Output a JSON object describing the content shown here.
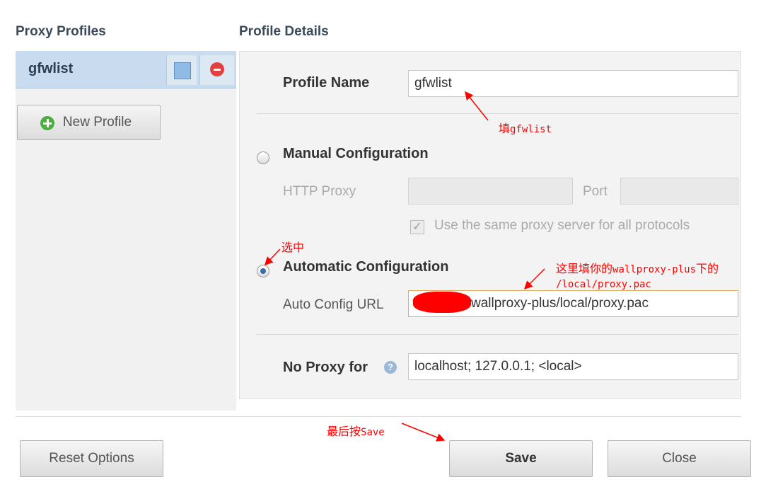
{
  "left": {
    "title": "Proxy Profiles",
    "profiles": [
      {
        "name": "gfwlist"
      }
    ],
    "new_profile_label": "New Profile"
  },
  "details": {
    "title": "Profile Details",
    "profile_name_label": "Profile Name",
    "profile_name_value": "gfwlist",
    "manual_label": "Manual Configuration",
    "http_proxy_label": "HTTP Proxy",
    "http_proxy_value": "",
    "port_label": "Port",
    "port_value": "",
    "same_proxy_label": "Use the same proxy server for all protocols",
    "same_proxy_checked": true,
    "automatic_label": "Automatic Configuration",
    "auto_url_label": "Auto Config URL",
    "auto_url_value": "wallproxy-plus/local/proxy.pac",
    "no_proxy_label": "No Proxy for",
    "no_proxy_value": "localhost; 127.0.0.1; <local>",
    "selected_mode": "automatic"
  },
  "footer": {
    "reset_label": "Reset Options",
    "save_label": "Save",
    "close_label": "Close"
  },
  "annotations": {
    "fill_prefix": "填",
    "fill_code": "gfwlist",
    "select": "选中",
    "url_note_prefix": "这里填你的",
    "url_note_code": "wallproxy-plus",
    "url_note_suffix": "下的",
    "url_note_path": "/local/proxy.pac",
    "save_note_prefix": "最后按",
    "save_note_code": "Save"
  },
  "colors": {
    "annotation": "#ff0000",
    "selected_profile_bg": "#c9dcef",
    "profile_color": "#8fbbe6"
  },
  "icons": [
    "color-swatch-icon",
    "delete-icon",
    "plus-icon",
    "help-icon",
    "check-icon"
  ]
}
